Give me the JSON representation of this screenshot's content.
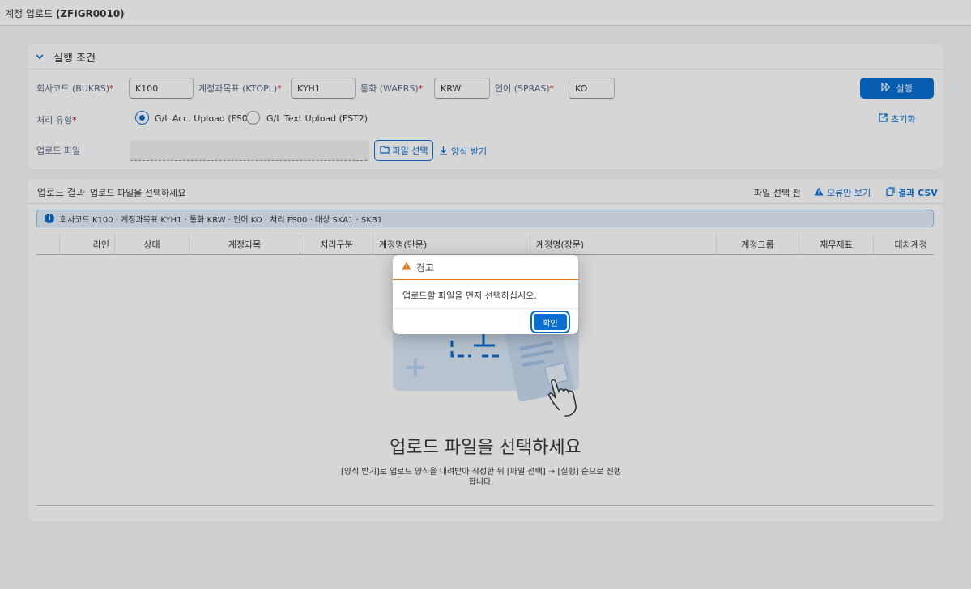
{
  "app": {
    "title_prefix": "계정 업로드 ",
    "title_code": "(ZFIGR0010)"
  },
  "conditions": {
    "header": "실행 조건",
    "bukrs_label": "회사코드 (BUKRS)",
    "bukrs_value": "K100",
    "ktopl_label": "계정과목표 (KTOPL)",
    "ktopl_value": "KYH1",
    "waers_label": "통화 (WAERS)",
    "waers_value": "KRW",
    "spras_label": "언어 (SPRAS)",
    "spras_value": "KO",
    "required_mark": "*",
    "run_label": "실행",
    "proc_label": "처리 유형",
    "radio1_label": "G/L Acc. Upload (FS00)",
    "radio2_label": "G/L Text Upload (FST2)",
    "reset_label": "초기화",
    "file_label": "업로드 파일",
    "file_select_label": "파일 선택",
    "template_label": "양식 받기"
  },
  "results": {
    "title": "업로드 결과",
    "subtitle": "업로드 파일을 선택하세요",
    "status_text": "파일 선택 전",
    "errors_only_label": "오류만 보기",
    "csv_label": "결과 CSV",
    "info_text": "회사코드 K100 · 계정과목표 KYH1 · 통화 KRW · 언어 KO · 처리 FS00 · 대상 SKA1 · SKB1",
    "columns": [
      "라인",
      "상태",
      "계정과목",
      "처리구분",
      "계정명(단문)",
      "계정명(장문)",
      "계정그룹",
      "재무제표",
      "대차계정"
    ],
    "empty_title": "업로드 파일을 선택하세요",
    "empty_desc": "[양식 받기]로 업로드 양식을 내려받아 작성한 뒤 [파일 선택] → [실행] 순으로 진행합니다."
  },
  "dialog": {
    "title": "경고",
    "message": "업로드할 파일을 먼저 선택하십시오.",
    "ok_label": "확인"
  },
  "colors": {
    "accent": "#0a6ed1",
    "warning": "#e9730c",
    "required": "#bb0000"
  }
}
